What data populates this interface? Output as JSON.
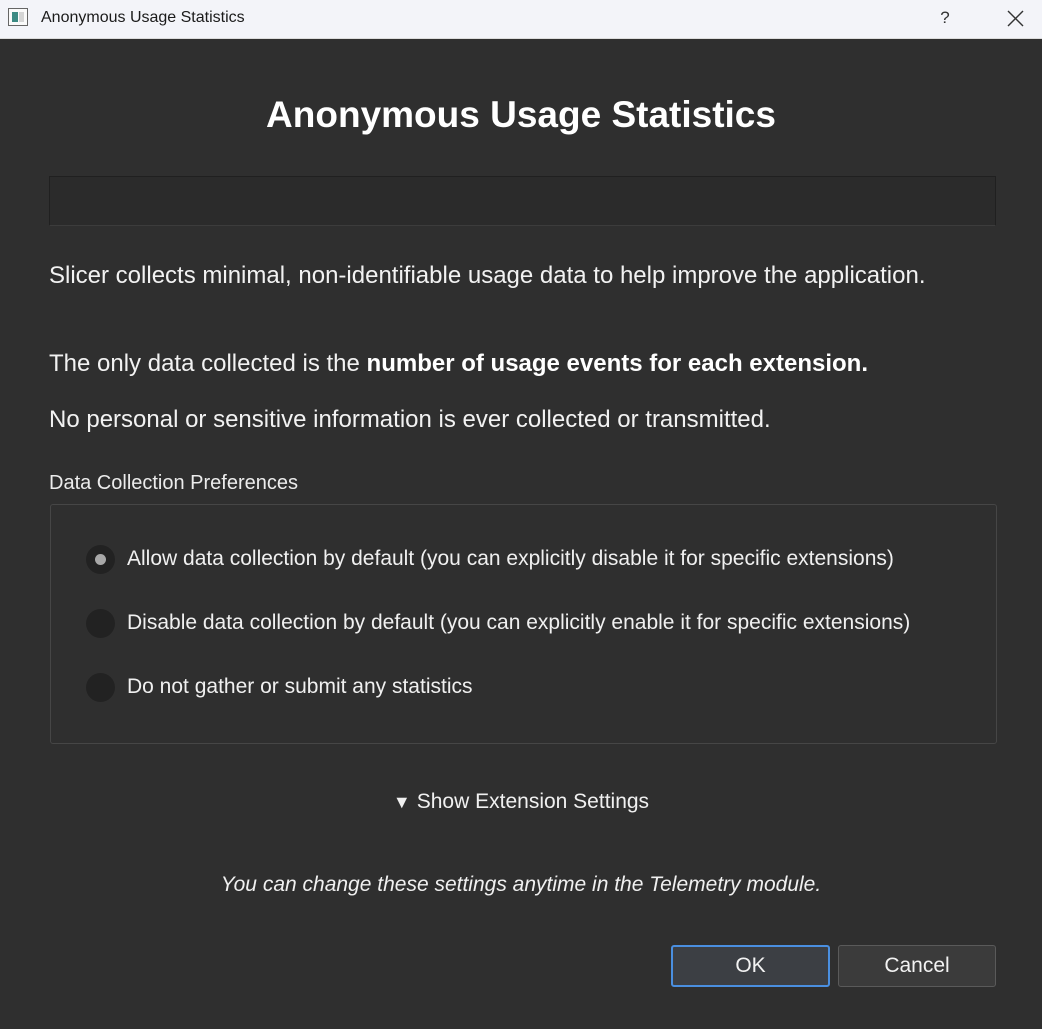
{
  "window": {
    "title": "Anonymous Usage Statistics",
    "help_label": "?"
  },
  "dialog": {
    "heading": "Anonymous Usage Statistics",
    "paragraph1": "Slicer collects minimal, non-identifiable usage data to help improve the application.",
    "paragraph2_prefix": "The only data collected is the ",
    "paragraph2_bold": "number of usage events for each extension.",
    "paragraph3": "No personal or sensitive information is ever collected or transmitted."
  },
  "preferences": {
    "label": "Data Collection Preferences",
    "options": [
      {
        "label": "Allow data collection by default (you can explicitly disable it for specific extensions)",
        "checked": true
      },
      {
        "label": "Disable data collection by default (you can explicitly enable it for specific extensions)",
        "checked": false
      },
      {
        "label": "Do not gather or submit any statistics",
        "checked": false
      }
    ]
  },
  "extension_toggle": {
    "arrow": "▼",
    "label": "Show Extension Settings"
  },
  "note": "You can change these settings anytime in the Telemetry module.",
  "buttons": {
    "ok": "OK",
    "cancel": "Cancel"
  },
  "colors": {
    "background": "#2f2f2f",
    "titlebar": "#f3f4f9",
    "focus_accent": "#4a8fe0"
  }
}
